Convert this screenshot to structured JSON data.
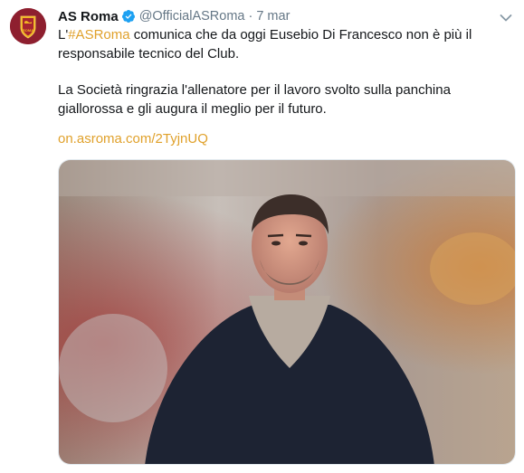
{
  "tweet": {
    "author_name": "AS Roma",
    "handle": "@OfficialASRoma",
    "separator": "·",
    "time": "7 mar",
    "text_prefix": "L'",
    "hashtag": "#ASRoma",
    "text_line1_rest": " comunica che da oggi Eusebio Di Francesco non è più il responsabile tecnico del Club.",
    "paragraph2": "La Società ringrazia l'allenatore per il lavoro svolto sulla panchina giallorossa e gli augura il meglio per il futuro.",
    "link": "on.asroma.com/2TyjnUQ",
    "avatar_text": "ROMA"
  },
  "colors": {
    "link_accent": "#e0a12b",
    "verified_blue": "#1da1f2",
    "avatar_bg": "#8e1f2f",
    "muted_text": "#657786"
  },
  "icons": {
    "verified": "verified-badge-icon",
    "caret": "chevron-down-icon"
  }
}
